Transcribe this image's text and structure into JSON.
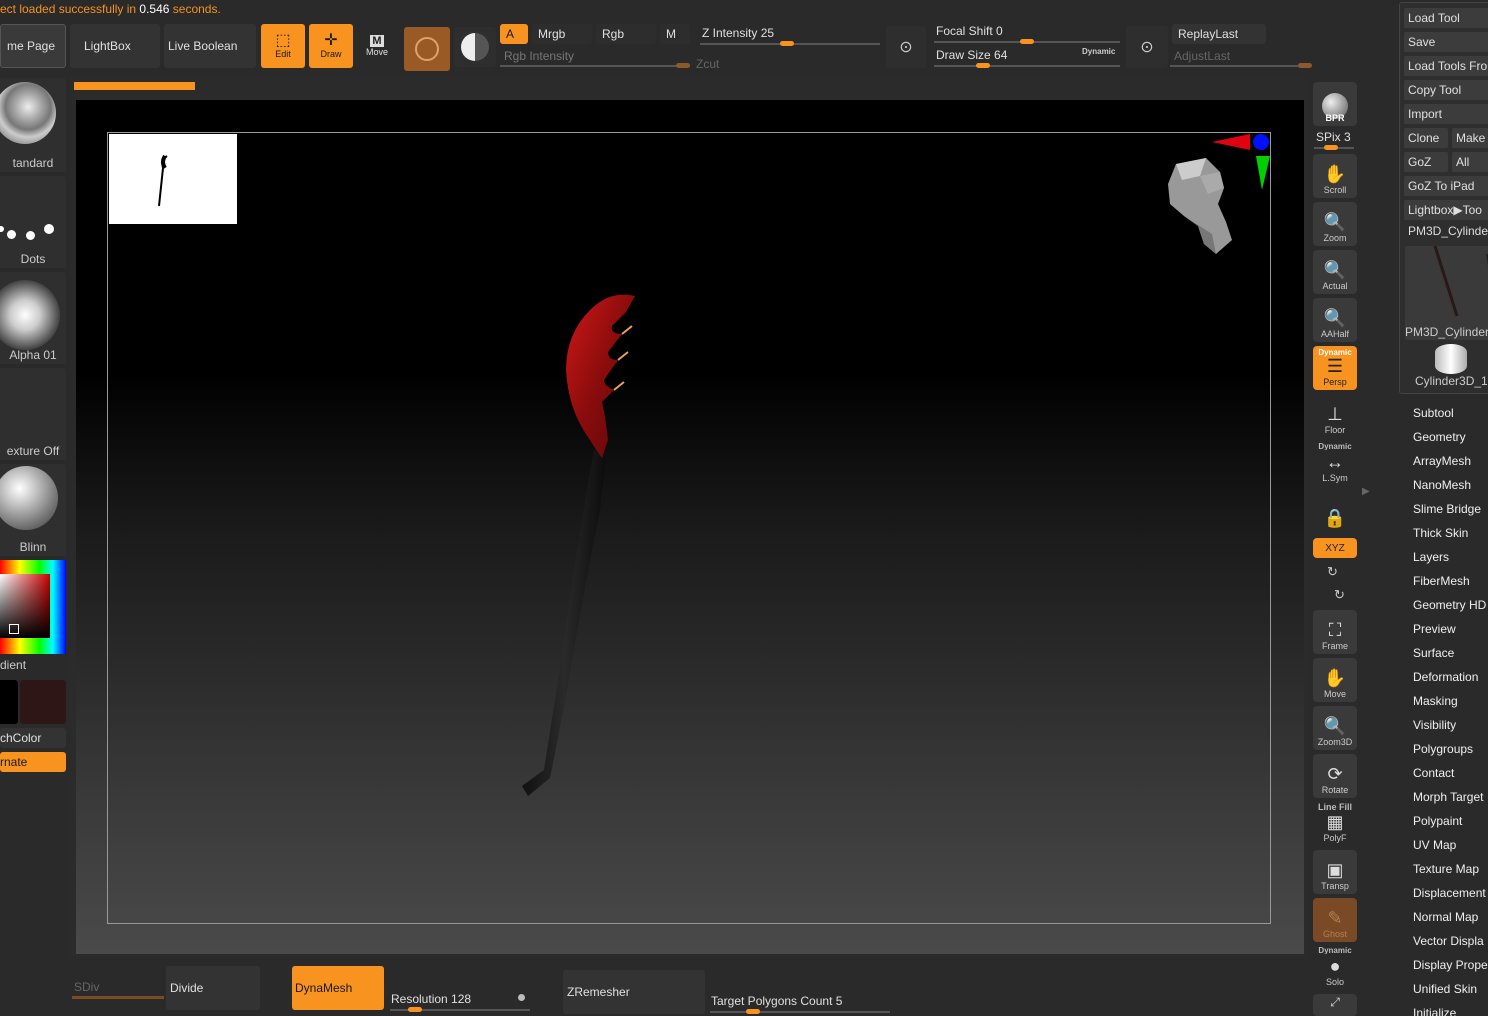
{
  "status": {
    "prefix": "ect loaded successfully in ",
    "time": "0.546",
    "suffix": " seconds."
  },
  "top_buttons": {
    "home_page": "me Page",
    "lightbox": "LightBox",
    "live_boolean": "Live Boolean",
    "edit": "Edit",
    "draw": "Draw",
    "move": "Move",
    "move_letter": "M"
  },
  "color_mode": {
    "a": "A",
    "mrgb": "Mrgb",
    "rgb": "Rgb",
    "m": "M",
    "rgb_intensity": "Rgb Intensity"
  },
  "z_intensity": {
    "label": "Z Intensity",
    "value": "25",
    "zcut": "Zcut"
  },
  "focal": {
    "focal_label": "Focal Shift",
    "focal_value": "0",
    "draw_label": "Draw Size",
    "draw_value": "64",
    "dynamic": "Dynamic"
  },
  "replay": {
    "replay_last": "ReplayLast",
    "adjust_last": "AdjustLast"
  },
  "left_panel": {
    "brush": "tandard",
    "stroke": "Dots",
    "alpha": "Alpha 01",
    "texture": "exture Off",
    "material": "Blinn",
    "gradient": "dient",
    "switch_color": "chColor",
    "alternate": "rnate"
  },
  "right_tools": {
    "load_tool": "Load Tool",
    "save": "Save",
    "load_tools_from": "Load Tools Fro",
    "copy_tool": "Copy Tool",
    "import": "Import",
    "clone": "Clone",
    "make": "Make",
    "goz": "GoZ",
    "all": "All",
    "goz_ipad": "GoZ To iPad",
    "lightbox_tool": "Lightbox▶Too",
    "current_tool": "PM3D_Cylinde",
    "thumb1": "PM3D_Cylinder",
    "thumb2": "Cylinder3D_1"
  },
  "tool_menu": [
    "Subtool",
    "Geometry",
    "ArrayMesh",
    "NanoMesh",
    "Slime Bridge",
    "Thick Skin",
    "Layers",
    "FiberMesh",
    "Geometry HD",
    "Preview",
    "Surface",
    "Deformation",
    "Masking",
    "Visibility",
    "Polygroups",
    "Contact",
    "Morph Target",
    "Polypaint",
    "UV Map",
    "Texture Map",
    "Displacement",
    "Normal Map",
    "Vector Displa",
    "Display Prope",
    "Unified Skin",
    "Initialize"
  ],
  "side_shelf": {
    "bpr": "BPR",
    "spix_label": "SPix",
    "spix_value": "3",
    "scroll": "Scroll",
    "zoom": "Zoom",
    "actual": "Actual",
    "aahalf": "AAHalf",
    "dynamic": "Dynamic",
    "persp": "Persp",
    "floor": "Floor",
    "lsym": "L.Sym",
    "xyz": "XYZ",
    "frame": "Frame",
    "move": "Move",
    "zoom3d": "Zoom3D",
    "rotate": "Rotate",
    "line_fill": "Line Fill",
    "polyf": "PolyF",
    "transp": "Transp",
    "ghost": "Ghost",
    "solo": "Solo"
  },
  "bottom": {
    "sdiv": "SDiv",
    "divide": "Divide",
    "dynamesh": "DynaMesh",
    "resolution_label": "Resolution",
    "resolution_value": "128",
    "zremesher": "ZRemesher",
    "target_label": "Target Polygons Count",
    "target_value": "5"
  },
  "colors": {
    "accent": "#f7931e",
    "panel": "#333333",
    "viewport_top": "#000000",
    "viewport_bottom": "#4a4a4a"
  }
}
